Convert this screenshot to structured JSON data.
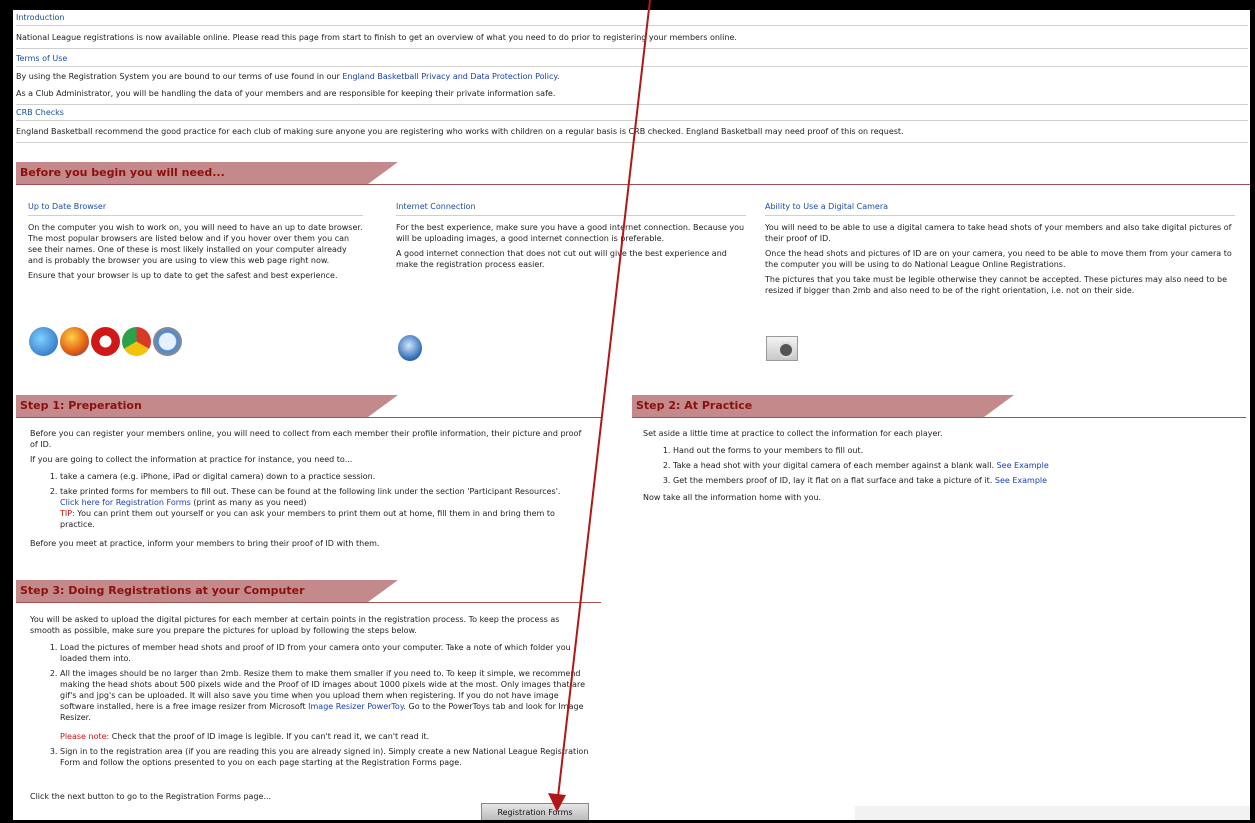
{
  "intro": {
    "heading": "Introduction",
    "text": "National League registrations is now available online. Please read this page from start to finish to get an overview of what you need to do prior to registering your members online."
  },
  "terms": {
    "heading": "Terms of Use",
    "text_before": "By using the Registration System you are bound to our terms of use found in our ",
    "link": "England Basketball Privacy and Data Protection Policy",
    "text_after": ".",
    "text2": "As a Club Administrator, you will be handling the data of your members and are responsible for keeping their private information safe."
  },
  "crb": {
    "heading": "CRB Checks",
    "text": "England Basketball recommend the good practice for each club of making sure anyone you are registering who works with children on a regular basis is CRB checked. England Basketball may need proof of this on request."
  },
  "before": {
    "title": "Before you begin you will need...",
    "browser": {
      "heading": "Up to Date Browser",
      "p1": "On the computer you wish to work on, you will need to have an up to date browser. The most popular browsers are listed below and if you hover over them you can see their names. One of these is most likely installed on your computer already and is probably the browser you are using to view this web page right now.",
      "p2": "Ensure that your browser is up to date to get the safest and best experience."
    },
    "internet": {
      "heading": "Internet Connection",
      "p1": "For the best experience, make sure you have a good internet connection. Because you will be uploading images, a good internet connection is preferable.",
      "p2": "A good internet connection that does not cut out will give the best experience and make the registration process easier."
    },
    "camera": {
      "heading": "Ability to Use a Digital Camera",
      "p1": "You will need to be able to use a digital camera to take head shots of your members and also take digital pictures of their proof of ID.",
      "p2": "Once the head shots and pictures of ID are on your camera, you need to be able to move them from your camera to the computer you will be using to do National League Online Registrations.",
      "p3": "The pictures that you take must be legible otherwise they cannot be accepted. These pictures may also need to be resized if bigger than 2mb and also need to be of the right orientation, i.e. not on their side."
    }
  },
  "step1": {
    "title": "Step 1: Preperation",
    "p1": "Before you can register your members online, you will need to collect from each member their profile information, their picture and proof of ID.",
    "p2": "If you are going to collect the information at practice for instance, you need to...",
    "item1": "take a camera (e.g. iPhone, iPad or digital camera) down to a practice session.",
    "item2": "take printed forms for members to fill out. These can be found at the following link under the section 'Participant Resources'.",
    "item2_link": "Click here for Registration Forms",
    "item2_after": " (print as many as you need)",
    "tip_label": "TIP:",
    "tip_text": " You can print them out yourself or you can ask your members to print them out at home, fill them in and bring them to practice.",
    "p3": "Before you meet at practice, inform your members to bring their proof of ID with them."
  },
  "step2": {
    "title": "Step 2: At Practice",
    "p1": "Set aside a little time at practice to collect the information for each player.",
    "item1": "Hand out the forms to your members to fill out.",
    "item2": "Take a head shot with your digital camera of each member against a blank wall. ",
    "item2_link": "See Example",
    "item3": "Get the members proof of ID, lay it flat on a flat surface and take a picture of it. ",
    "item3_link": "See Example",
    "p2": "Now take all the information home with you."
  },
  "step3": {
    "title": "Step 3: Doing Registrations at your Computer",
    "p1": "You will be asked to upload the digital pictures for each member at certain points in the registration process. To keep the process as smooth as possible, make sure you prepare the pictures for upload by following the steps below.",
    "item1": "Load the pictures of member head shots and proof of ID from your camera onto your computer. Take a note of which folder you loaded them into.",
    "item2": "All the images should be no larger than 2mb. Resize them to make them smaller if you need to. To keep it simple, we recommend making the head shots about 500 pixels wide and the Proof of ID images about 1000 pixels wide at the most. Only images that are gif's and jpg's can be uploaded. It will also save you time when you upload them when registering. If you do not have image software installed, here is a free image resizer from Microsoft ",
    "item2_link": "Image Resizer PowerToy",
    "item2_after": ". Go to the PowerToys tab and look for Image Resizer.",
    "note_label": "Please note:",
    "note_text": " Check that the proof of ID image is legible. If you can't read it, we can't read it.",
    "item3": "Sign in to the registration area (if you are reading this you are already signed in). Simply create a new National League Registration Form and follow the options presented to you on each page starting at the Registration Forms page.",
    "p2": "Click the next button to go to the Registration Forms page..."
  },
  "button": {
    "label": "Registration Forms"
  },
  "colors": {
    "banner": "#c4898a",
    "banner_title": "#8a1010",
    "link": "#1a3fb0",
    "arrow": "#b01818"
  }
}
